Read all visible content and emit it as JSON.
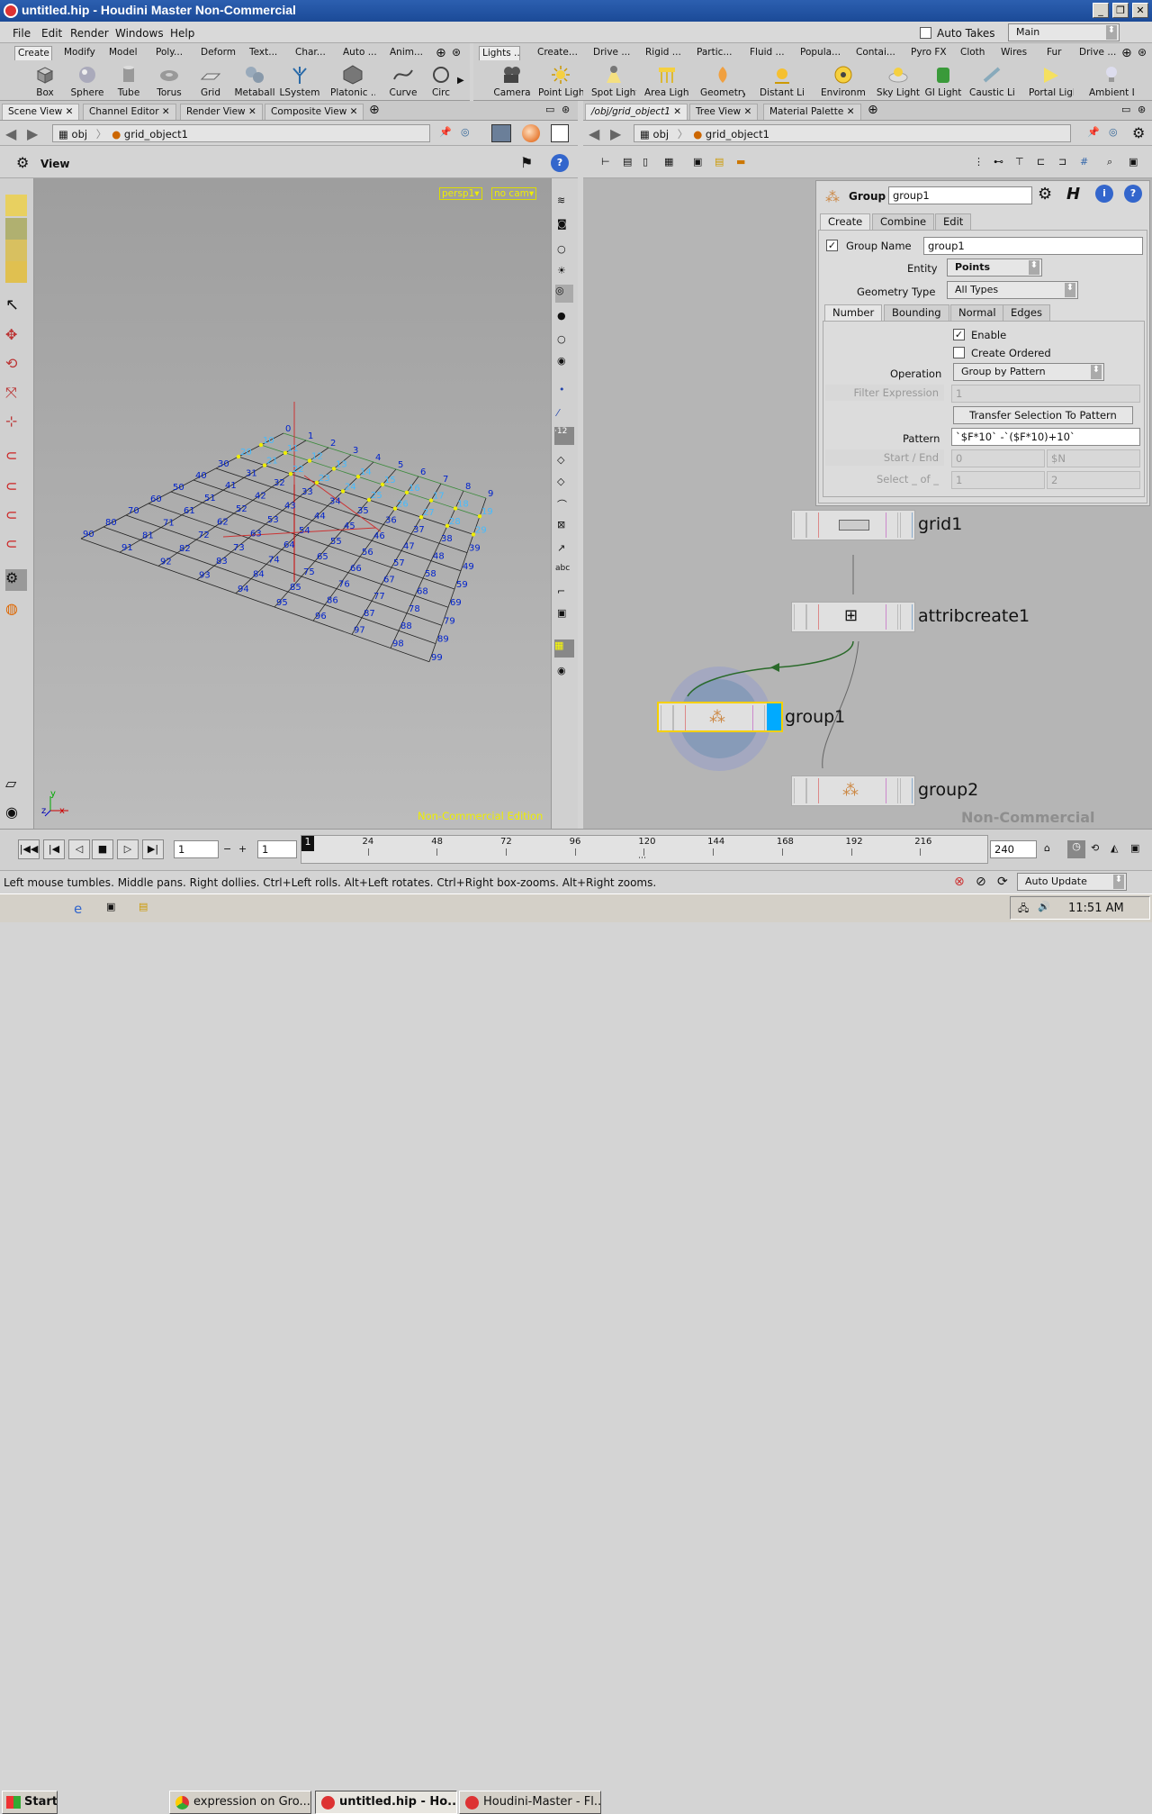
{
  "window": {
    "title": "untitled.hip - Houdini Master Non-Commercial"
  },
  "menubar": {
    "items": [
      "File",
      "Edit",
      "Render",
      "Windows",
      "Help"
    ],
    "auto_takes": "Auto Takes",
    "desktop": "Main"
  },
  "left_shelf": {
    "tabs": [
      "Create",
      "Modify",
      "Model",
      "Poly...",
      "Deform",
      "Text...",
      "Char...",
      "Auto ...",
      "Anim..."
    ],
    "tools": [
      "Box",
      "Sphere",
      "Tube",
      "Torus",
      "Grid",
      "Metaball",
      "LSystem",
      "Platonic ...",
      "Curve",
      "Circ"
    ]
  },
  "right_shelf": {
    "tabs": [
      "Lights ...",
      "Create...",
      "Drive ...",
      "Rigid ...",
      "Partic...",
      "Fluid ...",
      "Popula...",
      "Contai...",
      "Pyro FX",
      "Cloth",
      "Wires",
      "Fur",
      "Drive ..."
    ],
    "tools": [
      "Camera",
      "Point Light",
      "Spot Light",
      "Area Light",
      "Geometry...",
      "Distant Li...",
      "Environm...",
      "Sky Light",
      "GI Light",
      "Caustic Li...",
      "Portal Light",
      "Ambient L..."
    ]
  },
  "left_pane": {
    "tabs": [
      "Scene View",
      "Channel Editor",
      "Render View",
      "Composite View"
    ],
    "path_root": "obj",
    "path_node": "grid_object1",
    "view_label": "View",
    "persp": "persp1▾",
    "cam": "no cam▾",
    "watermark": "Non-Commercial Edition",
    "axes": {
      "x": "x",
      "y": "y",
      "z": "z"
    }
  },
  "right_pane": {
    "tabs": [
      "/obj/grid_object1",
      "Tree View",
      "Material Palette"
    ],
    "path_root": "obj",
    "path_node": "grid_object1",
    "watermark": "Non-Commercial Edition"
  },
  "params": {
    "type": "Group",
    "name": "group1",
    "tabs": [
      "Create",
      "Combine",
      "Edit"
    ],
    "group_name_label": "Group Name",
    "group_name": "group1",
    "entity_label": "Entity",
    "entity": "Points",
    "geotype_label": "Geometry Type",
    "geotype": "All Types",
    "subtabs": [
      "Number",
      "Bounding",
      "Normal",
      "Edges"
    ],
    "enable": "Enable",
    "create_ordered": "Create Ordered",
    "operation_label": "Operation",
    "operation": "Group by Pattern",
    "filter_label": "Filter Expression",
    "filter_value": "1",
    "transfer_btn": "Transfer Selection To Pattern",
    "pattern_label": "Pattern",
    "pattern": "`$F*10` -`($F*10)+10`",
    "startend_label": "Start / End",
    "start": "0",
    "end": "$N",
    "select_label": "Select _ of _",
    "sel1": "1",
    "sel2": "2"
  },
  "nodes": [
    {
      "name": "grid1"
    },
    {
      "name": "attribcreate1"
    },
    {
      "name": "group1"
    },
    {
      "name": "group2"
    }
  ],
  "timeline": {
    "frame": "1",
    "frame2": "1",
    "start_marker": "1",
    "ticks": [
      "24",
      "48",
      "72",
      "96",
      "120",
      "144",
      "168",
      "192",
      "216"
    ],
    "end": "240"
  },
  "status": {
    "text": "Left mouse tumbles. Middle pans. Right dollies. Ctrl+Left rolls. Alt+Left rotates. Ctrl+Right box-zooms. Alt+Right zooms.",
    "update": "Auto Update"
  },
  "taskbar": {
    "start": "Start",
    "items": [
      "expression on Gro...",
      "untitled.hip - Ho...",
      "Houdini-Master - Fl..."
    ],
    "time": "11:51 AM"
  },
  "grid_labels": [
    "0",
    "1",
    "2",
    "3",
    "4",
    "5",
    "6",
    "7",
    "8",
    "9",
    "10",
    "11",
    "12",
    "13",
    "14",
    "15",
    "16",
    "17",
    "18",
    "19",
    "20",
    "21",
    "22",
    "23",
    "24",
    "25",
    "26",
    "27",
    "28",
    "29",
    "30",
    "31",
    "32",
    "33",
    "34",
    "35",
    "36",
    "37",
    "38",
    "39",
    "40",
    "41",
    "42",
    "43",
    "44",
    "45",
    "46",
    "47",
    "48",
    "49",
    "50",
    "51",
    "52",
    "53",
    "54",
    "55",
    "56",
    "57",
    "58",
    "59",
    "60",
    "61",
    "62",
    "63",
    "64",
    "65",
    "66",
    "67",
    "68",
    "69",
    "70",
    "71",
    "72",
    "73",
    "74",
    "75",
    "76",
    "77",
    "78",
    "79",
    "80",
    "81",
    "82",
    "83",
    "84",
    "85",
    "86",
    "87",
    "88",
    "89",
    "90",
    "91",
    "92",
    "93",
    "94",
    "95",
    "96",
    "97",
    "98",
    "99"
  ]
}
